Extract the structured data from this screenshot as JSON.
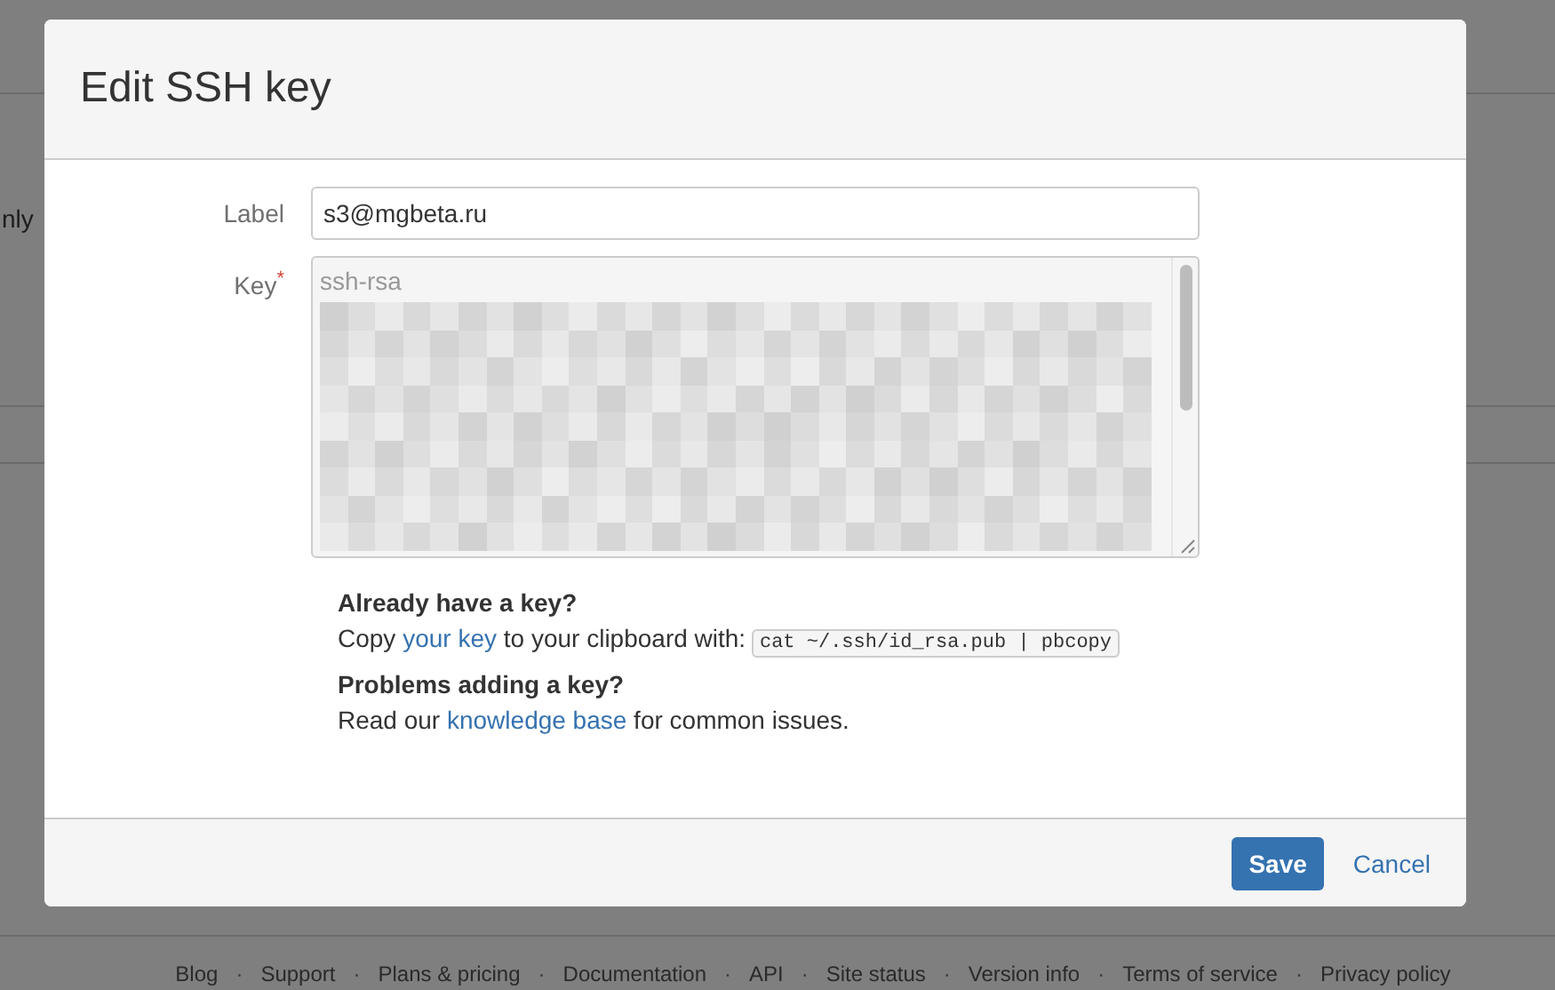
{
  "background_page": {
    "text_fragment": "nly",
    "footer_separator": "·",
    "footer_links": [
      "Blog",
      "Support",
      "Plans & pricing",
      "Documentation",
      "API",
      "Site status",
      "Version info",
      "Terms of service",
      "Privacy policy"
    ]
  },
  "dialog": {
    "title": "Edit SSH key",
    "fields": [
      {
        "kind": "input",
        "label": "Label",
        "value": "s3@mgbeta.ru"
      },
      {
        "kind": "textarea",
        "label": "Key",
        "required_mark": "*",
        "value": "ssh-rsa"
      }
    ],
    "help": [
      {
        "heading": "Already have a key?",
        "parts": [
          {
            "kind": "text",
            "text": "Copy "
          },
          {
            "kind": "link",
            "text": "your key"
          },
          {
            "kind": "text",
            "text": " to your clipboard with: "
          },
          {
            "kind": "code",
            "text": "cat ~/.ssh/id_rsa.pub | pbcopy"
          }
        ]
      },
      {
        "heading": "Problems adding a key?",
        "parts": [
          {
            "kind": "text",
            "text": "Read our "
          },
          {
            "kind": "link",
            "text": "knowledge base"
          },
          {
            "kind": "text",
            "text": " for common issues."
          }
        ]
      }
    ],
    "buttons": [
      {
        "kind": "primary",
        "label": "Save"
      },
      {
        "kind": "link",
        "label": "Cancel"
      }
    ]
  }
}
